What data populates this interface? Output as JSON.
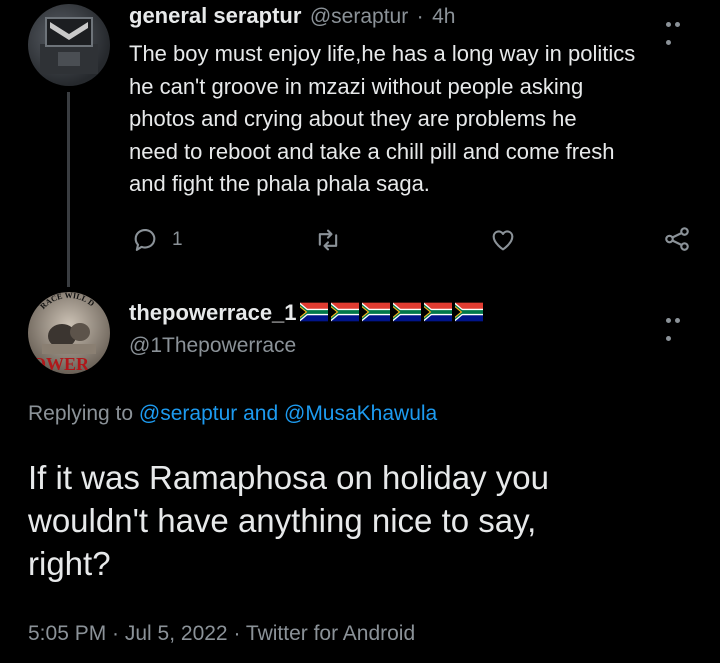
{
  "parent": {
    "display_name": "general seraptur",
    "handle": "@seraptur",
    "separator": "·",
    "time": "4h",
    "text_lines": [
      "The boy must enjoy life,he has a long way in politics",
      "he can't groove in mzazi without people asking",
      "photos and crying about  they are problems he",
      "need to reboot and take a chill pill and come fresh",
      "and fight the phala phala saga."
    ],
    "reply_count": "1"
  },
  "reply": {
    "display_name": "thepowerrace_1",
    "handle": "@1Thepowerrace",
    "flags_count": 6,
    "avatar_text_top": "RACE WILL D",
    "avatar_text_bottom": "OWER",
    "replying_prefix": "Replying to",
    "replying_to_1": "@seraptur",
    "replying_and": "and",
    "replying_to_2": "@MusaKhawula",
    "text_lines": [
      "If it was Ramaphosa on holiday you",
      "wouldn't have anything nice to say,",
      "right?"
    ],
    "timestamp": "5:05 PM · Jul 5, 2022 · Twitter for Android"
  },
  "icons": [
    "more-icon",
    "reply-icon",
    "retweet-icon",
    "like-icon",
    "share-icon",
    "sa-flag-icon"
  ],
  "colors": {
    "background": "#000000",
    "text": "#e7e9ea",
    "muted": "#8b9298",
    "link": "#1d9bf0"
  }
}
